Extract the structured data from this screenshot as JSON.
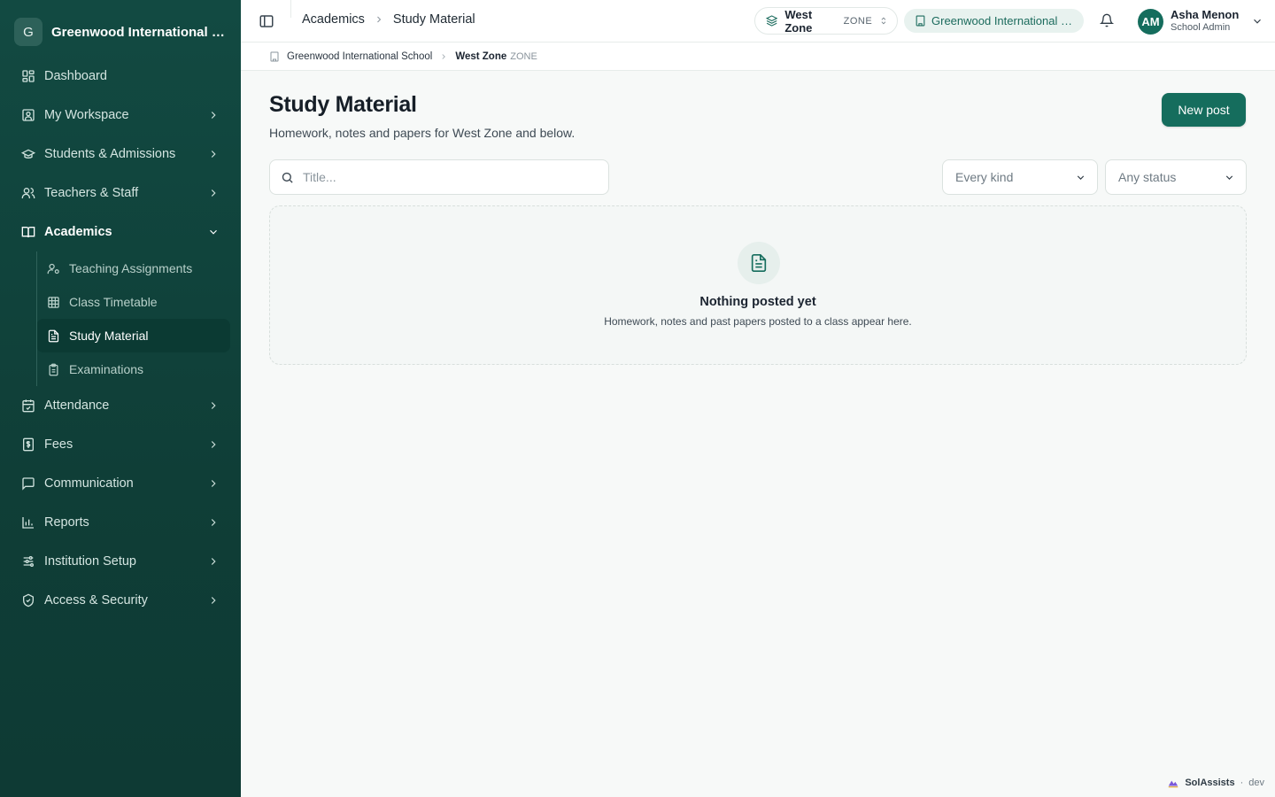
{
  "sidebar": {
    "brand_initial": "G",
    "brand_name": "Greenwood International School",
    "items": [
      {
        "label": "Dashboard"
      },
      {
        "label": "My Workspace"
      },
      {
        "label": "Students & Admissions"
      },
      {
        "label": "Teachers & Staff"
      },
      {
        "label": "Academics"
      },
      {
        "label": "Attendance"
      },
      {
        "label": "Fees"
      },
      {
        "label": "Communication"
      },
      {
        "label": "Reports"
      },
      {
        "label": "Institution Setup"
      },
      {
        "label": "Access & Security"
      }
    ],
    "academics_sub": [
      {
        "label": "Teaching Assignments"
      },
      {
        "label": "Class Timetable"
      },
      {
        "label": "Study Material"
      },
      {
        "label": "Examinations"
      }
    ]
  },
  "topbar": {
    "crumb_parent": "Academics",
    "crumb_current": "Study Material",
    "zone_name": "West Zone",
    "zone_tag": "ZONE",
    "school_name": "Greenwood International School",
    "user_initials": "AM",
    "user_name": "Asha Menon",
    "user_role": "School Admin"
  },
  "crumbbar": {
    "school": "Greenwood International School",
    "zone": "West Zone",
    "zone_tag": "ZONE"
  },
  "main": {
    "title": "Study Material",
    "subtitle": "Homework, notes and papers for West Zone and below.",
    "new_button": "New post",
    "search_placeholder": "Title...",
    "kind_filter": "Every kind",
    "status_filter": "Any status",
    "empty_title": "Nothing posted yet",
    "empty_desc": "Homework, notes and past papers posted to a class appear here."
  },
  "footer": {
    "brand": "SolAssists",
    "sep": "·",
    "env": "dev"
  },
  "colors": {
    "sidebar_bg": "#124a42",
    "accent": "#156d5d",
    "active_item_bg": "#0b3a33",
    "page_bg": "#f7f9f8"
  }
}
